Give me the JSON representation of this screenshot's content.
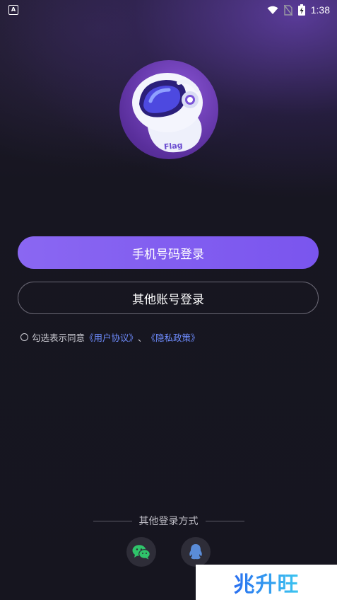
{
  "status_bar": {
    "time": "1:38",
    "app_icon_letter": "A"
  },
  "logo": {
    "badge_text": "Flag"
  },
  "buttons": {
    "phone_login": "手机号码登录",
    "other_account_login": "其他账号登录"
  },
  "agreement": {
    "prefix": "勾选表示同意",
    "user_agreement": "《用户协议》",
    "separator": "、",
    "privacy_policy": "《隐私政策》"
  },
  "other_login": {
    "label": "其他登录方式",
    "methods": [
      "wechat-icon",
      "qq-icon"
    ]
  },
  "watermark": {
    "text": "兆升旺"
  },
  "colors": {
    "primary_button": "#7a55ee",
    "link": "#6f8dff",
    "background": "#16151f"
  }
}
